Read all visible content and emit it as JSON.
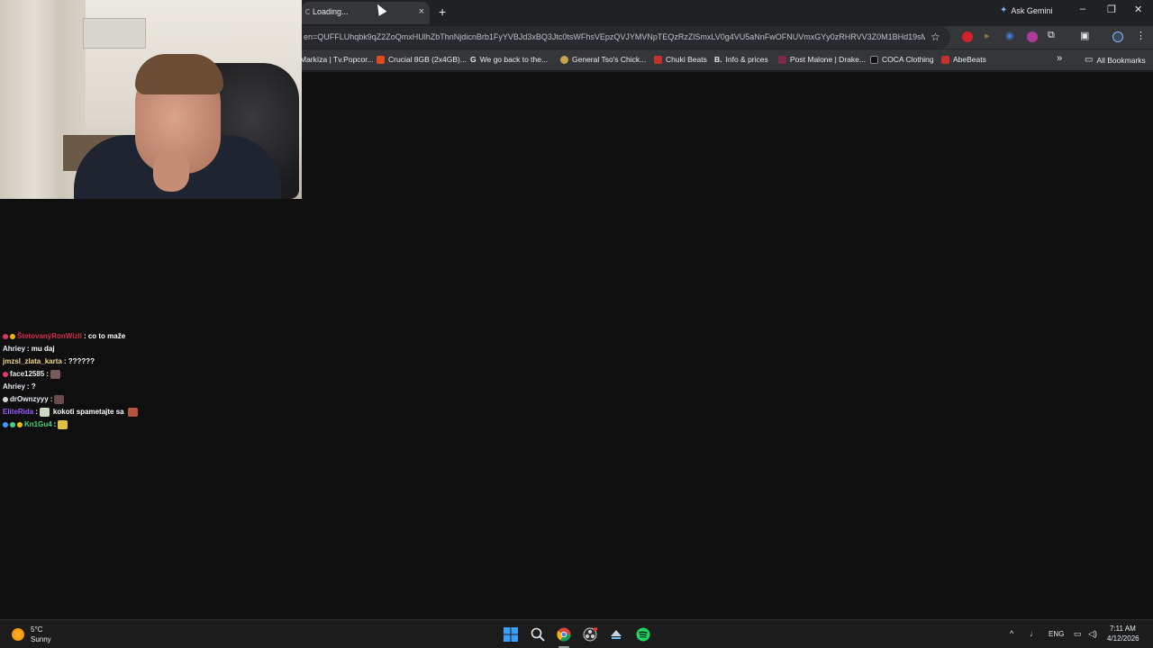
{
  "browser": {
    "tab": {
      "title": "Loading...",
      "close": "×"
    },
    "new_tab": "+",
    "ask_gemini": "Ask Gemini",
    "gemini_icon": "sparkle-icon",
    "window_controls": {
      "minimize": "–",
      "restore": "❐",
      "close": "✕"
    },
    "url": "en=QUFFLUhqbk9qZ2ZoQmxHUlhZbThnNjdicnBrb1FyYVBJd3xBQ3Jtc0tsWFhsVEpzQVJYMVNpTEQzRzZlSmxLV0g4VU5aNnFwOFNUVmxGYy0zRHRVV3Z0M1BHd19sM...",
    "bookmarks": [
      {
        "label": "Markíza | Tv.Popcor...",
        "color": "#35363a"
      },
      {
        "label": "Crucial 8GB (2x4GB)...",
        "color": "#e04a1f"
      },
      {
        "label": "We go back to the...",
        "color": "#4285f4",
        "glyph": "G"
      },
      {
        "label": "General Tso's Chick...",
        "color": "#c9a34a"
      },
      {
        "label": "Chuki Beats",
        "color": "#c4302b"
      },
      {
        "label": "Info & prices",
        "color": "#1f3b8a",
        "glyph": "B."
      },
      {
        "label": "Post Malone | Drake...",
        "color": "#7a2a4a"
      },
      {
        "label": "COCA Clothing",
        "color": "#111111"
      },
      {
        "label": "AbeBeats",
        "color": "#c4302b"
      }
    ],
    "bookmarks_more": "»",
    "all_bookmarks": "All Bookmarks"
  },
  "chat": [
    {
      "user": "ŠtetovanýRonWizll",
      "user_color": "#d42b4f",
      "message": ": co to maže",
      "badges": [
        "#e0365f",
        "#f0b400"
      ],
      "emotes": []
    },
    {
      "user": "Ahriey",
      "user_color": "#e8eaed",
      "message": ": mu daj",
      "badges": [],
      "emotes": []
    },
    {
      "user": "jmzsl_zlata_karta",
      "user_color": "#f0d58c",
      "message": ": ??????",
      "badges": [],
      "emotes": []
    },
    {
      "user": "face12585",
      "user_color": "#e8eaed",
      "message": ":",
      "badges": [
        "#e0365f"
      ],
      "emotes": [
        "#7a5b5b"
      ]
    },
    {
      "user": "Ahriey",
      "user_color": "#e8eaed",
      "message": ": ?",
      "badges": [],
      "emotes": []
    },
    {
      "user": "drOwnzyyy",
      "user_color": "#e8eaed",
      "message": ":",
      "badges": [
        "#d6d6d6"
      ],
      "emotes": [
        "#6a4a4a"
      ]
    },
    {
      "user": "EliteRida",
      "user_color": "#9b59ff",
      "message": ": ",
      "extra": "kokoti spametajte sa",
      "badges": [],
      "emotes": [
        "#cfd8c4",
        "#b4553c"
      ]
    },
    {
      "user": "Kn1Gu4",
      "user_color": "#3fd47a",
      "message": ":",
      "badges": [
        "#3a9bff",
        "#3fd47a",
        "#f0c000"
      ],
      "emotes": [
        "#e0c040"
      ]
    }
  ],
  "taskbar": {
    "weather_temp": "5°C",
    "weather_desc": "Sunny",
    "apps": [
      "windows-start-icon",
      "search-icon",
      "chrome-icon",
      "obs-icon",
      "steam-icon",
      "spotify-icon"
    ],
    "language": "ENG",
    "time": "7:11 AM",
    "date": "4/12/2026"
  }
}
